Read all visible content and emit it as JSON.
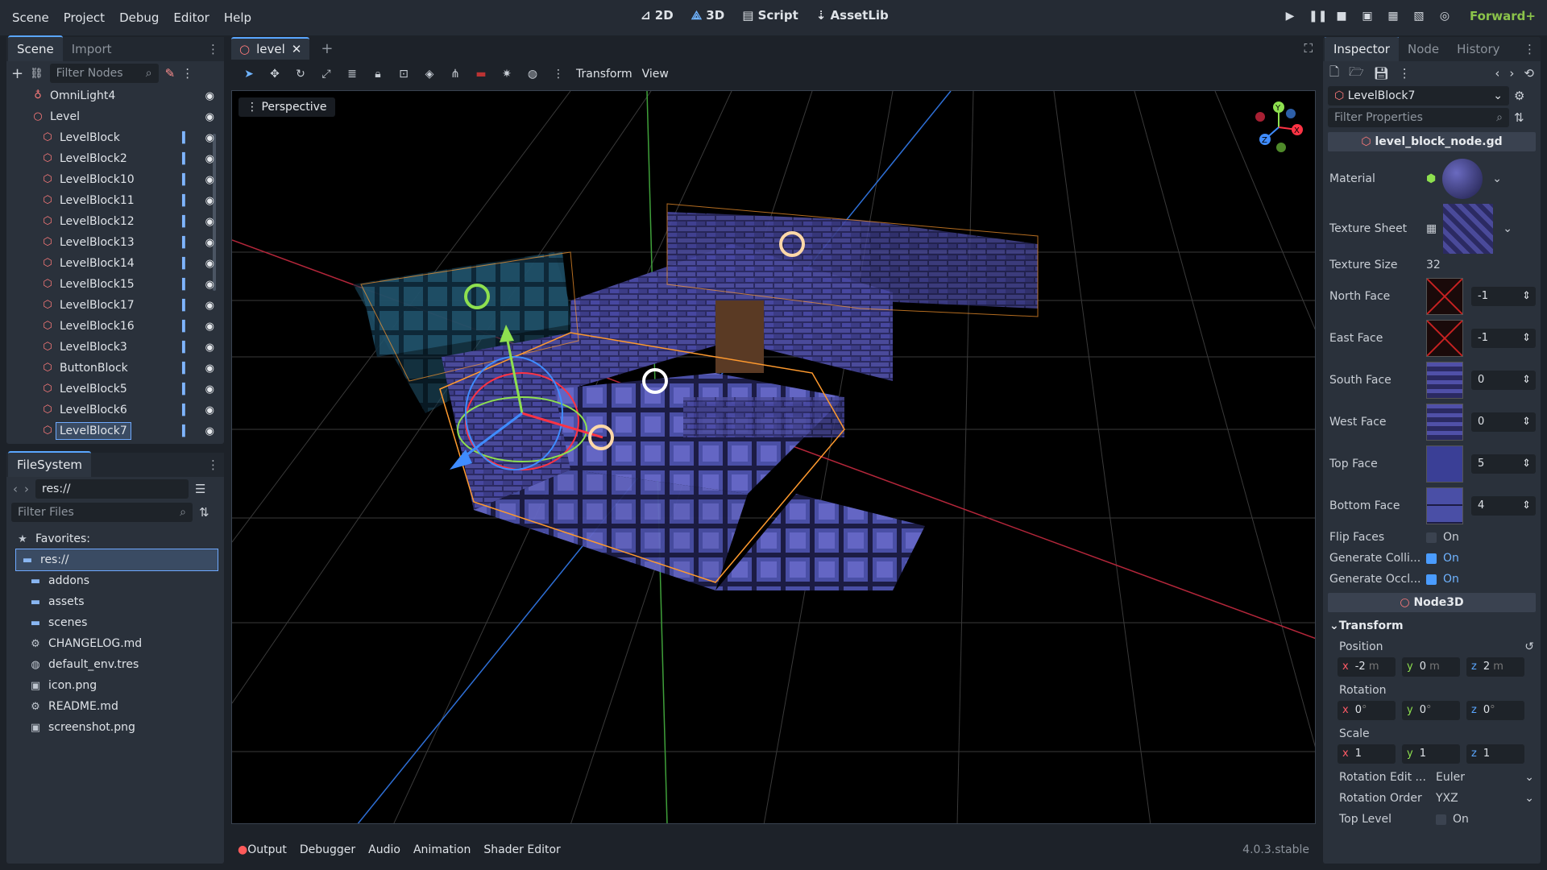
{
  "menu": [
    "Scene",
    "Project",
    "Debug",
    "Editor",
    "Help"
  ],
  "main_screens": {
    "two_d": "2D",
    "three_d": "3D",
    "script": "Script",
    "assetlib": "AssetLib"
  },
  "renderer": "Forward+",
  "scene_dock": {
    "tabs": [
      "Scene",
      "Import"
    ],
    "filter_placeholder": "Filter Nodes",
    "nodes": [
      {
        "label": "OmniLight4",
        "icon": "light-icon",
        "script": false
      },
      {
        "label": "Level",
        "icon": "node3d-icon",
        "script": false
      },
      {
        "label": "LevelBlock",
        "icon": "block-icon",
        "script": true
      },
      {
        "label": "LevelBlock2",
        "icon": "block-icon",
        "script": true
      },
      {
        "label": "LevelBlock10",
        "icon": "block-icon",
        "script": true
      },
      {
        "label": "LevelBlock11",
        "icon": "block-icon",
        "script": true
      },
      {
        "label": "LevelBlock12",
        "icon": "block-icon",
        "script": true
      },
      {
        "label": "LevelBlock13",
        "icon": "block-icon",
        "script": true
      },
      {
        "label": "LevelBlock14",
        "icon": "block-icon",
        "script": true
      },
      {
        "label": "LevelBlock15",
        "icon": "block-icon",
        "script": true
      },
      {
        "label": "LevelBlock17",
        "icon": "block-icon",
        "script": true
      },
      {
        "label": "LevelBlock16",
        "icon": "block-icon",
        "script": true
      },
      {
        "label": "LevelBlock3",
        "icon": "block-icon",
        "script": true
      },
      {
        "label": "ButtonBlock",
        "icon": "block-icon",
        "script": true
      },
      {
        "label": "LevelBlock5",
        "icon": "block-icon",
        "script": true
      },
      {
        "label": "LevelBlock6",
        "icon": "block-icon",
        "script": true
      },
      {
        "label": "LevelBlock7",
        "icon": "block-icon",
        "script": true,
        "selected": true
      }
    ]
  },
  "filesystem": {
    "tab": "FileSystem",
    "path": "res://",
    "filter_placeholder": "Filter Files",
    "favorites": "Favorites:",
    "items": [
      {
        "label": "res://",
        "icon": "folder-icon"
      },
      {
        "label": "addons",
        "icon": "folder-icon"
      },
      {
        "label": "assets",
        "icon": "folder-icon"
      },
      {
        "label": "scenes",
        "icon": "folder-icon"
      },
      {
        "label": "CHANGELOG.md",
        "icon": "gear-icon"
      },
      {
        "label": "default_env.tres",
        "icon": "globe-icon"
      },
      {
        "label": "icon.png",
        "icon": "image-icon"
      },
      {
        "label": "README.md",
        "icon": "gear-icon"
      },
      {
        "label": "screenshot.png",
        "icon": "image-icon"
      }
    ]
  },
  "editor": {
    "scene_tab": "level",
    "toolbar_menus": [
      "Transform",
      "View"
    ],
    "perspective": "Perspective",
    "bottom_tabs": [
      "Output",
      "Debugger",
      "Audio",
      "Animation",
      "Shader Editor"
    ],
    "version": "4.0.3.stable"
  },
  "inspector": {
    "tabs": [
      "Inspector",
      "Node",
      "History"
    ],
    "node_name": "LevelBlock7",
    "filter_placeholder": "Filter Properties",
    "script_header": "level_block_node.gd",
    "material_label": "Material",
    "texture_sheet_label": "Texture Sheet",
    "texture_size": {
      "label": "Texture Size",
      "value": "32"
    },
    "faces": [
      {
        "label": "North Face",
        "value": "-1",
        "thumb": "empty"
      },
      {
        "label": "East Face",
        "value": "-1",
        "thumb": "empty"
      },
      {
        "label": "South Face",
        "value": "0",
        "thumb": "brick"
      },
      {
        "label": "West Face",
        "value": "0",
        "thumb": "brick"
      },
      {
        "label": "Top Face",
        "value": "5",
        "thumb": "tile"
      },
      {
        "label": "Bottom Face",
        "value": "4",
        "thumb": "grid"
      }
    ],
    "flip_faces": {
      "label": "Flip Faces",
      "value": "On",
      "checked": false
    },
    "generate_collision": {
      "label": "Generate Colli...",
      "value": "On",
      "checked": true
    },
    "generate_occlusion": {
      "label": "Generate Occl...",
      "value": "On",
      "checked": true
    },
    "node3d_header": "Node3D",
    "transform_header": "Transform",
    "position": {
      "label": "Position",
      "x": "-2",
      "y": "0",
      "z": "2",
      "unit": "m"
    },
    "rotation": {
      "label": "Rotation",
      "x": "0",
      "y": "0",
      "z": "0",
      "unit": "°"
    },
    "scale": {
      "label": "Scale",
      "x": "1",
      "y": "1",
      "z": "1"
    },
    "rotation_edit": {
      "label": "Rotation Edit ...",
      "value": "Euler"
    },
    "rotation_order": {
      "label": "Rotation Order",
      "value": "YXZ"
    },
    "top_level": {
      "label": "Top Level",
      "value": "On",
      "checked": false
    }
  },
  "colors": {
    "accent": "#5aa7ff",
    "renderer": "#8bc34a",
    "selection": "#ff9a2e",
    "x_axis": "#ff4455",
    "y_axis": "#8ee04f",
    "z_axis": "#3f8cff"
  }
}
